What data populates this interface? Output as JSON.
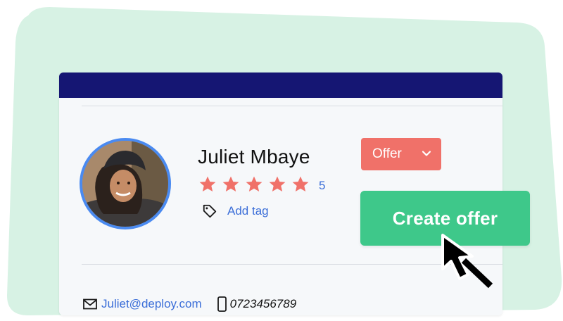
{
  "profile": {
    "name": "Juliet Mbaye",
    "rating_count": "5",
    "add_tag_label": "Add tag",
    "email": "Juliet@deploy.com",
    "phone": "0723456789"
  },
  "offer_dropdown": {
    "selected": "Offer"
  },
  "create_offer_label": "Create offer",
  "rating": {
    "stars_filled": 5,
    "stars_total": 5
  },
  "colors": {
    "topbar": "#151673",
    "blob": "#d7f2e4",
    "accent_blue": "#3b6ed8",
    "coral": "#f07169",
    "green": "#3ec88a",
    "avatar_ring": "#4a8af0"
  },
  "icons": {
    "star": "star-icon",
    "tag": "tag-icon",
    "mail": "mail-icon",
    "phone": "phone-icon",
    "dropdown": "chevron-down-icon",
    "cursor": "mouse-pointer-icon"
  }
}
